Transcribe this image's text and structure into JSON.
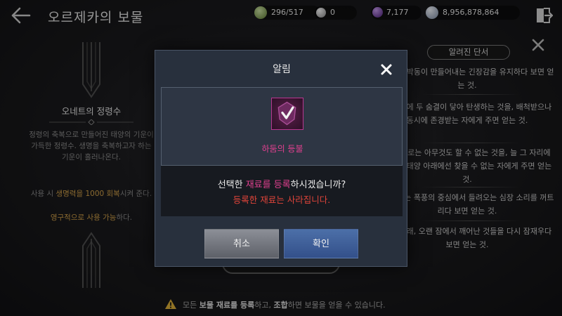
{
  "header": {
    "title": "오르제카의 보물",
    "back_icon": "arrow-left-icon",
    "exit_icon": "exit-door-icon",
    "currencies": [
      {
        "name": "energy",
        "value": "296/517",
        "icon": "energy-orb-icon"
      },
      {
        "name": "pearl",
        "value": "0",
        "icon": "pearl-icon"
      },
      {
        "name": "gem",
        "value": "7,177",
        "icon": "purple-gem-icon"
      },
      {
        "name": "silver",
        "value": "8,956,878,864",
        "icon": "silver-coin-icon"
      }
    ]
  },
  "left_panel": {
    "item_name": "오네트의 정령수",
    "description": "정령의 축복으로 만들어진 태양의 기운이 가득한 정령수. 생명을 축복하고자 하는 기운이 흘러나온다.",
    "usage_prefix": "사용 시 ",
    "usage_highlight": "생명력을 1000 회복",
    "usage_suffix": "시켜 준다.",
    "permanent_highlight": "영구적으로 사용 가능",
    "permanent_suffix": "하다."
  },
  "right_panel": {
    "header": "알려진 단서",
    "close_icon": "close-icon",
    "clues": [
      "은 심장 박동이 만들어내는 긴장감을 유지하다 보면 얻는 것.",
      "세 풀잎에 두 숨결이 닿아 탄생하는 것을, 배척받으나 동시에 존경받는 자에게 주면 얻는 것.",
      "그 자체로는 아무것도 할 수 없는 것을, 늘 그 자리에 있으나 태양 아래에선 찾을 수 없는 자에게 주면 얻는 것.",
      "지지 않는 폭풍의 중심에서 들려오는 심장 소리를 꺼트리다 보면 얻는 것.",
      "태양 아래, 오랜 잠에서 깨어난 것들을 다시 잠재우다 보면 얻는 것."
    ]
  },
  "notice": {
    "icon": "warning-icon",
    "part1": "모든 ",
    "bold1": "보물 재료를 등록",
    "part2": "하고, ",
    "bold2": "조합",
    "part3": "하면 보물을 얻을 수 있습니다."
  },
  "dialog": {
    "title": "알림",
    "close_icon": "close-icon",
    "item_icon": "purple-crest-checkmark-icon",
    "item_name": "하둠의 등불",
    "confirm_prefix": "선택한 ",
    "confirm_highlight": "재료를 등록",
    "confirm_suffix": "하시겠습니까?",
    "warning": "등록한 재료는 사라집니다.",
    "cancel_label": "취소",
    "ok_label": "확인"
  },
  "colors": {
    "accent_pink": "#e0408f",
    "warning_red": "#e0443a",
    "highlight_yellow": "#d6a44a",
    "ok_button": "#3f5f98",
    "cancel_button": "#767981"
  }
}
